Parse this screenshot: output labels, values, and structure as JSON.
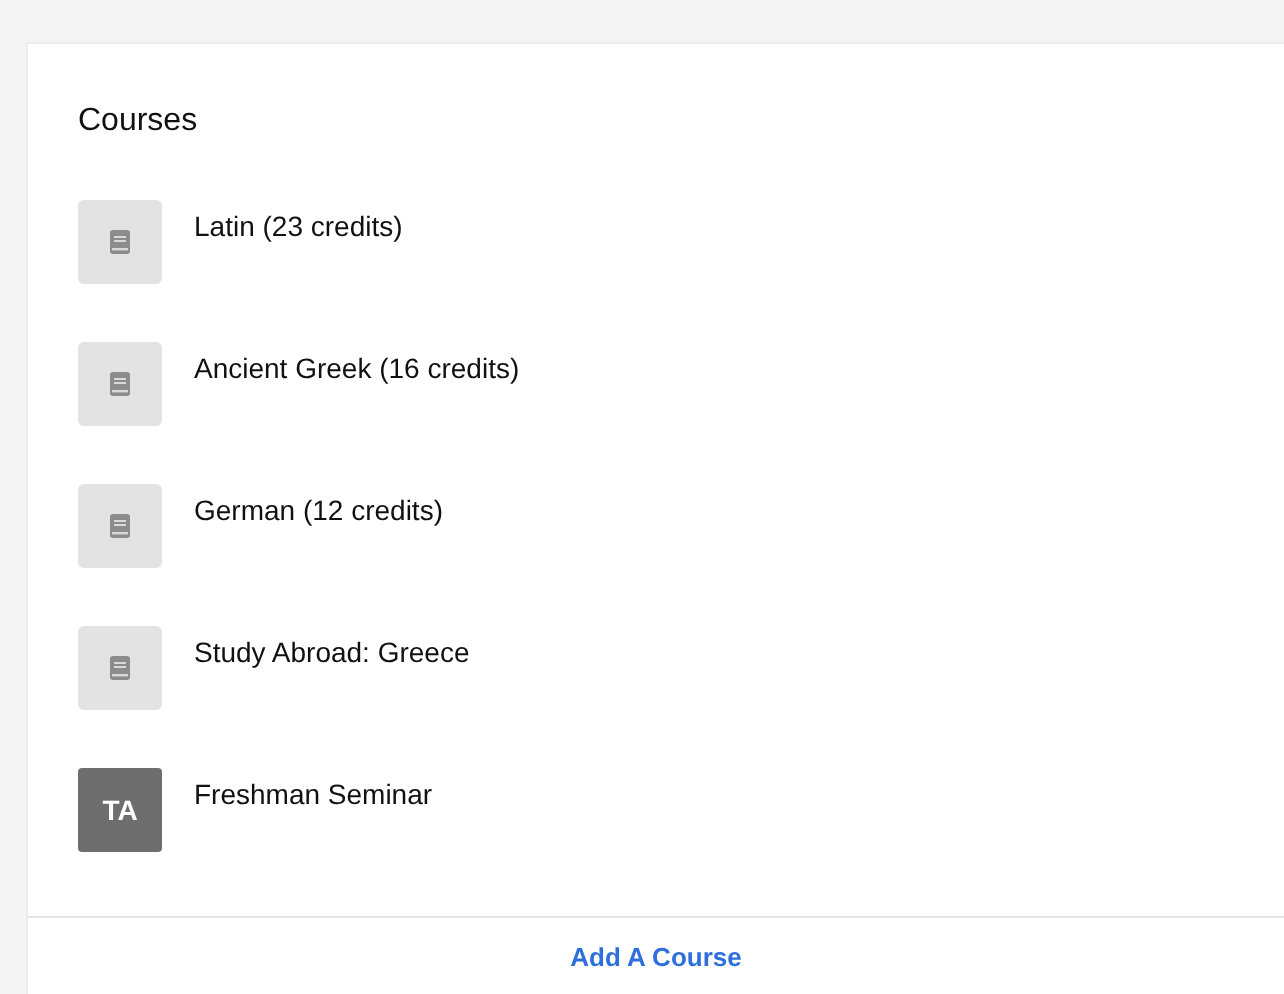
{
  "title": "Courses",
  "courses": [
    {
      "name": "Latin (23 credits)",
      "kind": "book"
    },
    {
      "name": "Ancient Greek (16 credits)",
      "kind": "book"
    },
    {
      "name": "German (12 credits)",
      "kind": "book"
    },
    {
      "name": "Study Abroad: Greece",
      "kind": "book"
    },
    {
      "name": "Freshman Seminar",
      "kind": "initials",
      "initials": "TA"
    }
  ],
  "action": "Add A Course"
}
